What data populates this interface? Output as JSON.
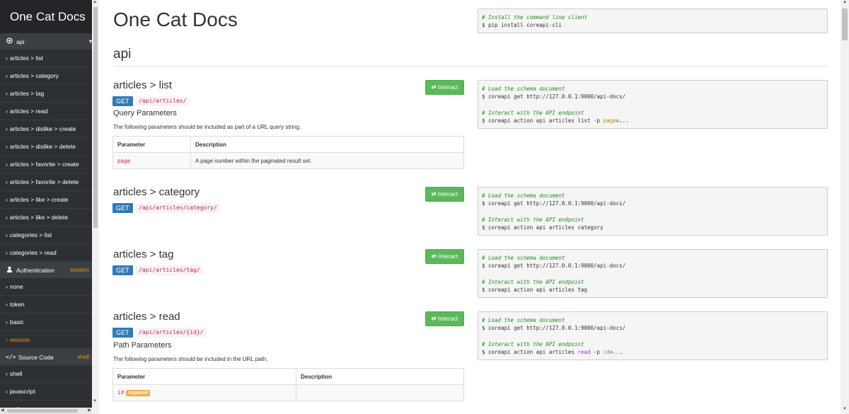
{
  "app": {
    "title": "One Cat Docs"
  },
  "sidebar": {
    "api_section": {
      "label": "api",
      "icon": "target-icon",
      "caret": "▾"
    },
    "api_items": [
      "articles > list",
      "articles > category",
      "articles > tag",
      "articles > read",
      "articles > dislike > create",
      "articles > dislike > delete",
      "articles > favorite > create",
      "articles > favorite > delete",
      "articles > like > create",
      "articles > like > delete",
      "categories > list",
      "categories > read"
    ],
    "auth_section": {
      "label": "Authentication",
      "right": "session",
      "icon": "user-icon"
    },
    "auth_items": [
      "none",
      "token",
      "basic",
      "session"
    ],
    "auth_active": "session",
    "source_section": {
      "label": "Source Code",
      "right": "shell",
      "icon": "code-icon"
    },
    "source_items": [
      "shell",
      "javascript",
      "python"
    ],
    "chevron": "›"
  },
  "main": {
    "page_title": "One Cat Docs",
    "install_code": {
      "comment": "# Install the command line client",
      "cmd": "$ pip install coreapi-cli"
    },
    "group_title": "api",
    "interact_label": "⇄ Interact",
    "schema_comment": "# Load the schema document",
    "schema_cmd": "$ coreapi get http://127.0.0.1:9000/api-docs/",
    "interact_comment": "# Interact with the API endpoint",
    "endpoints": [
      {
        "title": "articles > list",
        "method": "GET",
        "path": "/api/articles/",
        "params_title": "Query Parameters",
        "params_desc": "The following parameters should be included as part of a URL query string.",
        "table_headers": [
          "Parameter",
          "Description"
        ],
        "params": [
          {
            "name": "page",
            "desc": "A page number within the paginated result set."
          }
        ],
        "cmd_prefix": "$ coreapi action api articles list -p ",
        "cmd_hl": "page",
        "cmd_suffix": "=..."
      },
      {
        "title": "articles > category",
        "method": "GET",
        "path": "/api/articles/category/",
        "cmd": "$ coreapi action api articles category"
      },
      {
        "title": "articles > tag",
        "method": "GET",
        "path": "/api/articles/tag/",
        "cmd": "$ coreapi action api articles tag"
      },
      {
        "title": "articles > read",
        "method": "GET",
        "path": "/api/articles/{id}/",
        "params_title": "Path Parameters",
        "params_desc": "The following parameters should be included in the URL path.",
        "table_headers": [
          "Parameter",
          "Description"
        ],
        "params": [
          {
            "name": "id",
            "badge": "required",
            "desc": ""
          }
        ],
        "cmd_prefix": "$ coreapi action api articles ",
        "cmd_kw": "read",
        "cmd_mid": " -p ",
        "cmd_hl": "id",
        "cmd_suffix": "=..."
      }
    ]
  },
  "colors": {
    "sidebar_bg": "#2c2f33",
    "accent": "#e69900",
    "get": "#337ab7",
    "interact": "#5cb85c",
    "path": "#c7254e"
  }
}
